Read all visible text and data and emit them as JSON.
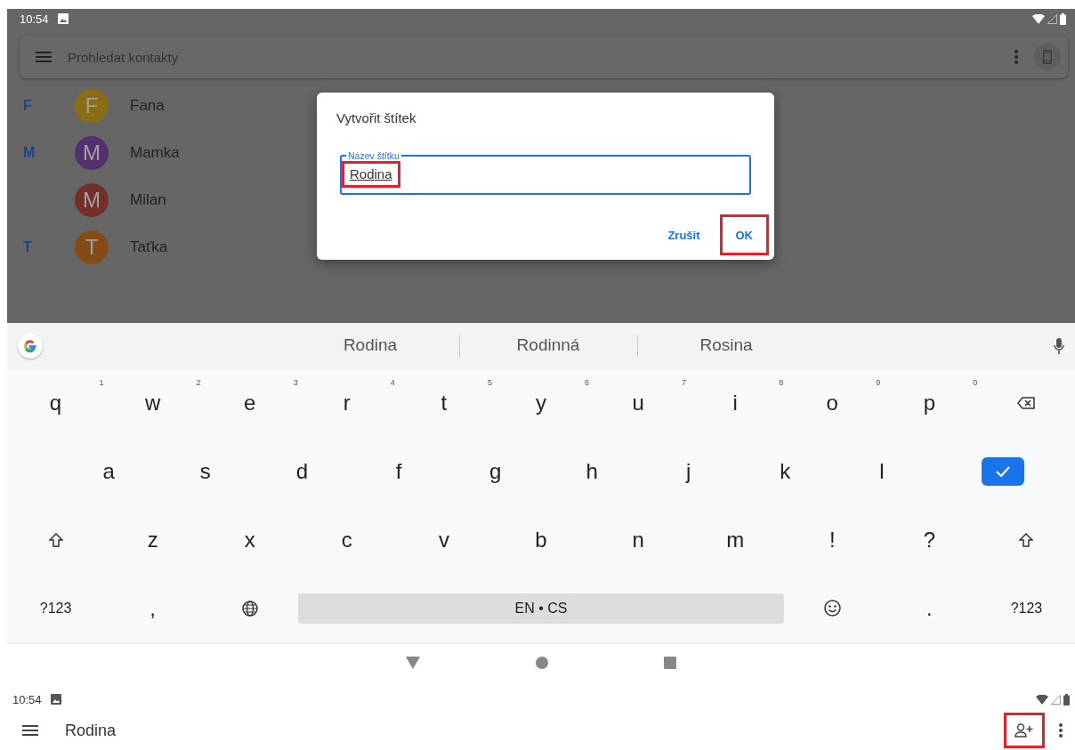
{
  "top_screen": {
    "status_bar": {
      "time": "10:54"
    },
    "search_bar": {
      "placeholder": "Prohledat kontakty"
    },
    "contacts": [
      {
        "section": "F",
        "initial": "F",
        "name": "Fana",
        "color": "#8a6d12"
      },
      {
        "section": "M",
        "initial": "M",
        "name": "Mamka",
        "color": "#55306f"
      },
      {
        "initial": "M",
        "name": "Milan",
        "color": "#743028"
      },
      {
        "section": "T",
        "initial": "T",
        "name": "Taťka",
        "color": "#864a16"
      }
    ],
    "dialog": {
      "title": "Vytvořit štítek",
      "field": {
        "label": "Název štítku",
        "value": "Rodina",
        "highlighted": true
      },
      "buttons": [
        {
          "label": "Zrušit",
          "highlighted": false
        },
        {
          "label": "OK",
          "highlighted": true
        }
      ]
    },
    "keyboard": {
      "suggestions": [
        "Rodina",
        "Rodinná",
        "Rosina"
      ],
      "rows": [
        [
          {
            "kind": "char",
            "label": "q",
            "hint": "1"
          },
          {
            "kind": "char",
            "label": "w",
            "hint": "2"
          },
          {
            "kind": "char",
            "label": "e",
            "hint": "3"
          },
          {
            "kind": "char",
            "label": "r",
            "hint": "4"
          },
          {
            "kind": "char",
            "label": "t",
            "hint": "5"
          },
          {
            "kind": "char",
            "label": "y",
            "hint": "6"
          },
          {
            "kind": "char",
            "label": "u",
            "hint": "7"
          },
          {
            "kind": "char",
            "label": "i",
            "hint": "8"
          },
          {
            "kind": "char",
            "label": "o",
            "hint": "9"
          },
          {
            "kind": "char",
            "label": "p",
            "hint": "0"
          },
          {
            "kind": "backspace"
          }
        ],
        [
          {
            "kind": "offset"
          },
          {
            "kind": "char",
            "label": "a"
          },
          {
            "kind": "char",
            "label": "s"
          },
          {
            "kind": "char",
            "label": "d"
          },
          {
            "kind": "char",
            "label": "f"
          },
          {
            "kind": "char",
            "label": "g"
          },
          {
            "kind": "char",
            "label": "h"
          },
          {
            "kind": "char",
            "label": "j"
          },
          {
            "kind": "char",
            "label": "k"
          },
          {
            "kind": "char",
            "label": "l"
          },
          {
            "kind": "enter"
          }
        ],
        [
          {
            "kind": "shift"
          },
          {
            "kind": "char",
            "label": "z"
          },
          {
            "kind": "char",
            "label": "x"
          },
          {
            "kind": "char",
            "label": "c"
          },
          {
            "kind": "char",
            "label": "v"
          },
          {
            "kind": "char",
            "label": "b"
          },
          {
            "kind": "char",
            "label": "n"
          },
          {
            "kind": "char",
            "label": "m"
          },
          {
            "kind": "char",
            "label": "!"
          },
          {
            "kind": "char",
            "label": "?"
          },
          {
            "kind": "shift"
          }
        ]
      ],
      "bottom_row": {
        "left_keys": [
          {
            "kind": "symbols",
            "label": "?123"
          },
          {
            "kind": "char",
            "label": ","
          },
          {
            "kind": "globe"
          }
        ],
        "space_label": "EN • CS",
        "right_keys": [
          {
            "kind": "emoji"
          },
          {
            "kind": "char",
            "label": "."
          },
          {
            "kind": "symbols",
            "label": "?123"
          }
        ]
      }
    }
  },
  "bottom_screen": {
    "status_bar": {
      "time": "10:54"
    },
    "toolbar": {
      "title": "Rodina",
      "add_contact_highlighted": true
    }
  }
}
